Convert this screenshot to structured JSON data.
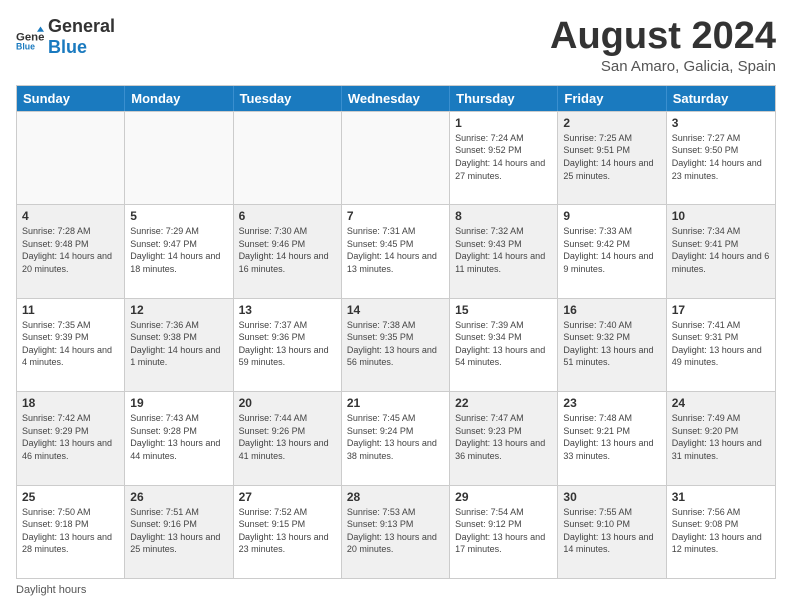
{
  "header": {
    "logo": {
      "general": "General",
      "blue": "Blue"
    },
    "title": "August 2024",
    "subtitle": "San Amaro, Galicia, Spain"
  },
  "days_of_week": [
    "Sunday",
    "Monday",
    "Tuesday",
    "Wednesday",
    "Thursday",
    "Friday",
    "Saturday"
  ],
  "weeks": [
    [
      {
        "day": "",
        "info": "",
        "shaded": false,
        "empty": true
      },
      {
        "day": "",
        "info": "",
        "shaded": false,
        "empty": true
      },
      {
        "day": "",
        "info": "",
        "shaded": false,
        "empty": true
      },
      {
        "day": "",
        "info": "",
        "shaded": false,
        "empty": true
      },
      {
        "day": "1",
        "info": "Sunrise: 7:24 AM\nSunset: 9:52 PM\nDaylight: 14 hours and 27 minutes.",
        "shaded": false,
        "empty": false
      },
      {
        "day": "2",
        "info": "Sunrise: 7:25 AM\nSunset: 9:51 PM\nDaylight: 14 hours and 25 minutes.",
        "shaded": true,
        "empty": false
      },
      {
        "day": "3",
        "info": "Sunrise: 7:27 AM\nSunset: 9:50 PM\nDaylight: 14 hours and 23 minutes.",
        "shaded": false,
        "empty": false
      }
    ],
    [
      {
        "day": "4",
        "info": "Sunrise: 7:28 AM\nSunset: 9:48 PM\nDaylight: 14 hours and 20 minutes.",
        "shaded": true,
        "empty": false
      },
      {
        "day": "5",
        "info": "Sunrise: 7:29 AM\nSunset: 9:47 PM\nDaylight: 14 hours and 18 minutes.",
        "shaded": false,
        "empty": false
      },
      {
        "day": "6",
        "info": "Sunrise: 7:30 AM\nSunset: 9:46 PM\nDaylight: 14 hours and 16 minutes.",
        "shaded": true,
        "empty": false
      },
      {
        "day": "7",
        "info": "Sunrise: 7:31 AM\nSunset: 9:45 PM\nDaylight: 14 hours and 13 minutes.",
        "shaded": false,
        "empty": false
      },
      {
        "day": "8",
        "info": "Sunrise: 7:32 AM\nSunset: 9:43 PM\nDaylight: 14 hours and 11 minutes.",
        "shaded": true,
        "empty": false
      },
      {
        "day": "9",
        "info": "Sunrise: 7:33 AM\nSunset: 9:42 PM\nDaylight: 14 hours and 9 minutes.",
        "shaded": false,
        "empty": false
      },
      {
        "day": "10",
        "info": "Sunrise: 7:34 AM\nSunset: 9:41 PM\nDaylight: 14 hours and 6 minutes.",
        "shaded": true,
        "empty": false
      }
    ],
    [
      {
        "day": "11",
        "info": "Sunrise: 7:35 AM\nSunset: 9:39 PM\nDaylight: 14 hours and 4 minutes.",
        "shaded": false,
        "empty": false
      },
      {
        "day": "12",
        "info": "Sunrise: 7:36 AM\nSunset: 9:38 PM\nDaylight: 14 hours and 1 minute.",
        "shaded": true,
        "empty": false
      },
      {
        "day": "13",
        "info": "Sunrise: 7:37 AM\nSunset: 9:36 PM\nDaylight: 13 hours and 59 minutes.",
        "shaded": false,
        "empty": false
      },
      {
        "day": "14",
        "info": "Sunrise: 7:38 AM\nSunset: 9:35 PM\nDaylight: 13 hours and 56 minutes.",
        "shaded": true,
        "empty": false
      },
      {
        "day": "15",
        "info": "Sunrise: 7:39 AM\nSunset: 9:34 PM\nDaylight: 13 hours and 54 minutes.",
        "shaded": false,
        "empty": false
      },
      {
        "day": "16",
        "info": "Sunrise: 7:40 AM\nSunset: 9:32 PM\nDaylight: 13 hours and 51 minutes.",
        "shaded": true,
        "empty": false
      },
      {
        "day": "17",
        "info": "Sunrise: 7:41 AM\nSunset: 9:31 PM\nDaylight: 13 hours and 49 minutes.",
        "shaded": false,
        "empty": false
      }
    ],
    [
      {
        "day": "18",
        "info": "Sunrise: 7:42 AM\nSunset: 9:29 PM\nDaylight: 13 hours and 46 minutes.",
        "shaded": true,
        "empty": false
      },
      {
        "day": "19",
        "info": "Sunrise: 7:43 AM\nSunset: 9:28 PM\nDaylight: 13 hours and 44 minutes.",
        "shaded": false,
        "empty": false
      },
      {
        "day": "20",
        "info": "Sunrise: 7:44 AM\nSunset: 9:26 PM\nDaylight: 13 hours and 41 minutes.",
        "shaded": true,
        "empty": false
      },
      {
        "day": "21",
        "info": "Sunrise: 7:45 AM\nSunset: 9:24 PM\nDaylight: 13 hours and 38 minutes.",
        "shaded": false,
        "empty": false
      },
      {
        "day": "22",
        "info": "Sunrise: 7:47 AM\nSunset: 9:23 PM\nDaylight: 13 hours and 36 minutes.",
        "shaded": true,
        "empty": false
      },
      {
        "day": "23",
        "info": "Sunrise: 7:48 AM\nSunset: 9:21 PM\nDaylight: 13 hours and 33 minutes.",
        "shaded": false,
        "empty": false
      },
      {
        "day": "24",
        "info": "Sunrise: 7:49 AM\nSunset: 9:20 PM\nDaylight: 13 hours and 31 minutes.",
        "shaded": true,
        "empty": false
      }
    ],
    [
      {
        "day": "25",
        "info": "Sunrise: 7:50 AM\nSunset: 9:18 PM\nDaylight: 13 hours and 28 minutes.",
        "shaded": false,
        "empty": false
      },
      {
        "day": "26",
        "info": "Sunrise: 7:51 AM\nSunset: 9:16 PM\nDaylight: 13 hours and 25 minutes.",
        "shaded": true,
        "empty": false
      },
      {
        "day": "27",
        "info": "Sunrise: 7:52 AM\nSunset: 9:15 PM\nDaylight: 13 hours and 23 minutes.",
        "shaded": false,
        "empty": false
      },
      {
        "day": "28",
        "info": "Sunrise: 7:53 AM\nSunset: 9:13 PM\nDaylight: 13 hours and 20 minutes.",
        "shaded": true,
        "empty": false
      },
      {
        "day": "29",
        "info": "Sunrise: 7:54 AM\nSunset: 9:12 PM\nDaylight: 13 hours and 17 minutes.",
        "shaded": false,
        "empty": false
      },
      {
        "day": "30",
        "info": "Sunrise: 7:55 AM\nSunset: 9:10 PM\nDaylight: 13 hours and 14 minutes.",
        "shaded": true,
        "empty": false
      },
      {
        "day": "31",
        "info": "Sunrise: 7:56 AM\nSunset: 9:08 PM\nDaylight: 13 hours and 12 minutes.",
        "shaded": false,
        "empty": false
      }
    ]
  ],
  "footer": {
    "note": "Daylight hours"
  }
}
